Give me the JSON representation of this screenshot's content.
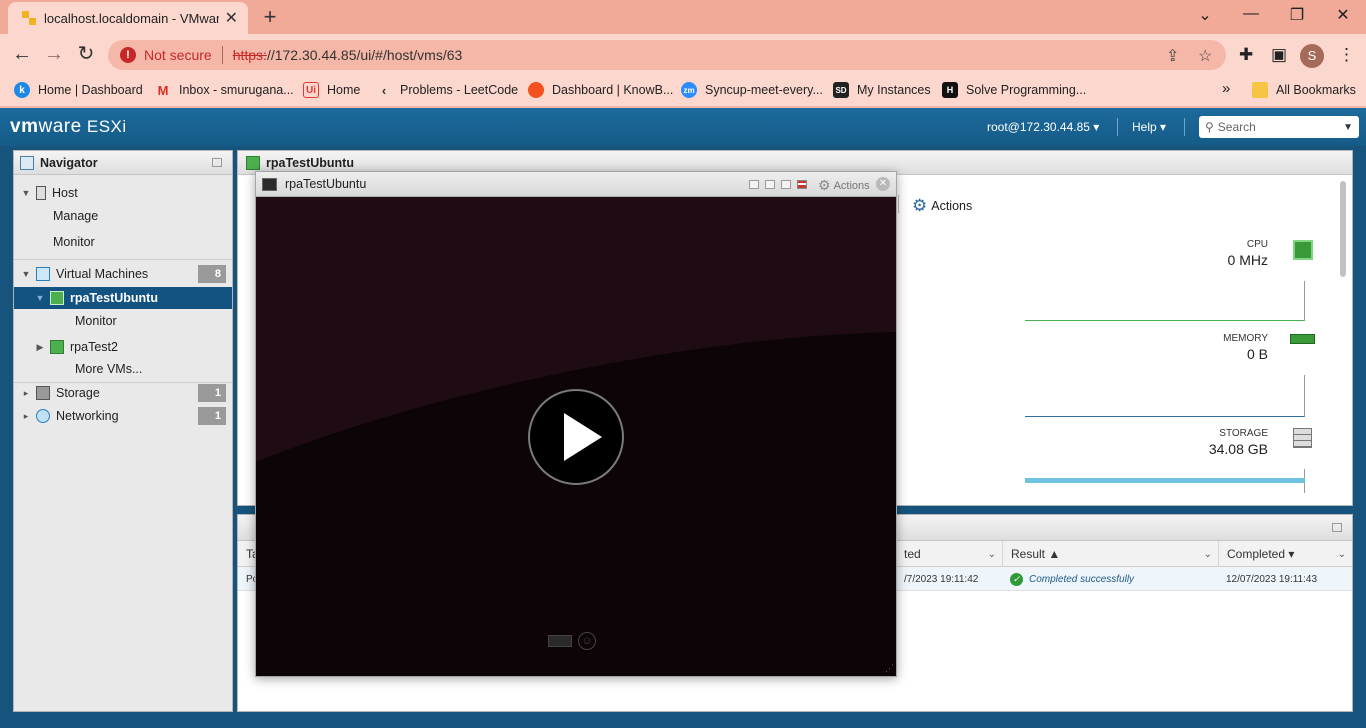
{
  "browser": {
    "tab_title": "localhost.localdomain - VMware",
    "new_tab": "+",
    "window_controls": [
      "⌄",
      "—",
      "❐",
      "✕"
    ],
    "security_label": "Not secure",
    "url_scheme": "https:",
    "url_rest": "//172.30.44.85/ui/#/host/vms/63",
    "profile_initial": "S",
    "bookmarks": [
      {
        "label": "Home | Dashboard",
        "icon": "K",
        "color": "#1e88e5"
      },
      {
        "label": "Inbox - smurugana...",
        "icon": "M",
        "color": "#ffffff"
      },
      {
        "label": "Home",
        "icon": "Ui",
        "color": "#ffffff"
      },
      {
        "label": "Problems - LeetCode",
        "icon": "L",
        "color": "#ffffff"
      },
      {
        "label": "Dashboard | KnowB...",
        "icon": "K",
        "color": "#f4511e"
      },
      {
        "label": "Syncup-meet-every...",
        "icon": "zm",
        "color": "#2d8cff"
      },
      {
        "label": "My Instances",
        "icon": "SD",
        "color": "#222222"
      },
      {
        "label": "Solve Programming...",
        "icon": "H",
        "color": "#111111"
      }
    ],
    "bookmarks_overflow": "»",
    "all_bookmarks": "All Bookmarks"
  },
  "esxi": {
    "logo_prefix": "vm",
    "logo_suffix": "ware",
    "logo_product": " ESXi",
    "user": "root@172.30.44.85 ▾",
    "help": "Help ▾",
    "search_placeholder": "Search"
  },
  "navigator": {
    "title": "Navigator",
    "host": "Host",
    "manage": "Manage",
    "monitor": "Monitor",
    "virtual_machines": "Virtual Machines",
    "vm_count": "8",
    "vm_selected": "rpaTestUbuntu",
    "vm_selected_monitor": "Monitor",
    "vm_other": "rpaTest2",
    "more_vms": "More VMs...",
    "storage": "Storage",
    "storage_count": "1",
    "networking": "Networking",
    "networking_count": "1"
  },
  "vm_panel": {
    "title": "rpaTestUbuntu",
    "actions": "Actions",
    "cpu_label": "CPU",
    "cpu_value": "0 MHz",
    "memory_label": "MEMORY",
    "memory_value": "0 B",
    "storage_label": "STORAGE",
    "storage_value": "34.08 GB",
    "accent_cpu": "#4caf50",
    "accent_memory": "#2e6f9e",
    "accent_storage": "#6fc3e0"
  },
  "tasks": {
    "col_task": "Ta",
    "col_started": "ted",
    "col_result": "Result ▲",
    "col_completed": "Completed ▾",
    "row_task": "Po",
    "row_started": "/7/2023 19:11:42",
    "row_result": "Completed successfully",
    "row_completed": "12/07/2023 19:11:43"
  },
  "console": {
    "title": "rpaTestUbuntu",
    "actions": "Actions",
    "close": "✕"
  }
}
